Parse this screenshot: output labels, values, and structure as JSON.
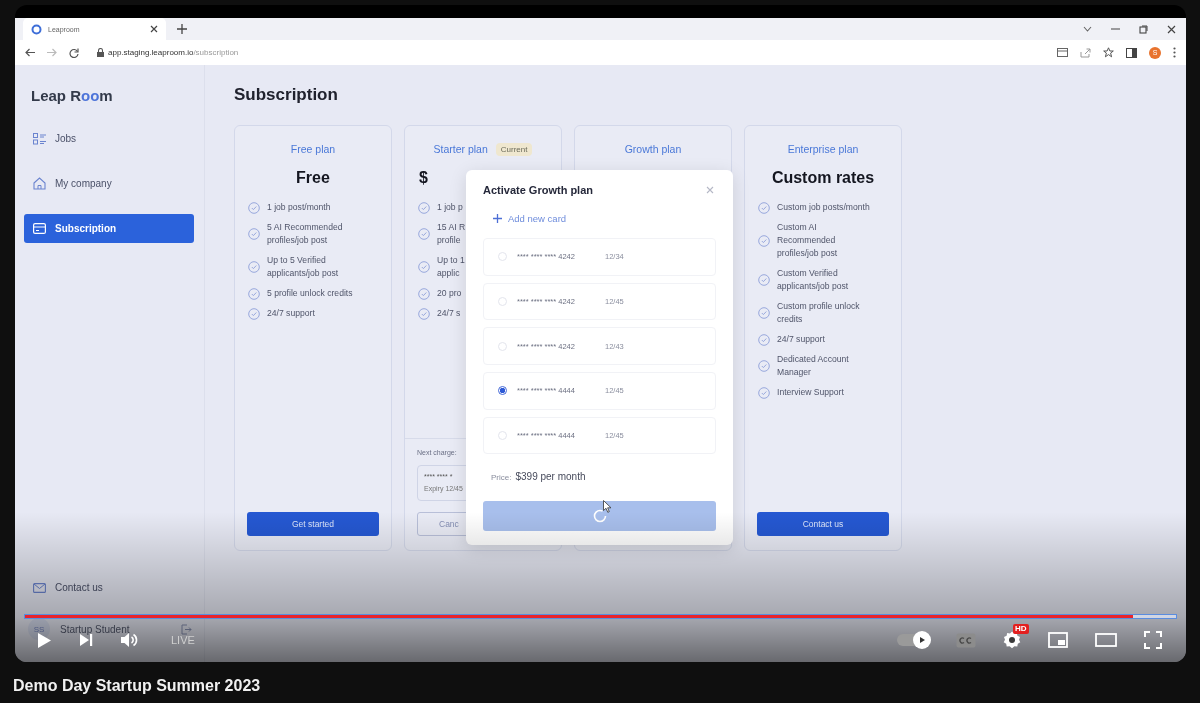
{
  "browser": {
    "tab": {
      "title": "Leaproom"
    },
    "address": {
      "host": "app.staging.leaproom.io",
      "path": "/subscription"
    },
    "profile_initial": "S"
  },
  "sidebar": {
    "logo": [
      {
        "text": "Leap R",
        "accent": false
      },
      {
        "text": "oo",
        "accent": true
      },
      {
        "text": "m",
        "accent": false
      }
    ],
    "items": [
      {
        "label": "Jobs",
        "selected": false
      },
      {
        "label": "My company",
        "selected": false
      },
      {
        "label": "Subscription",
        "selected": true
      }
    ],
    "contact": {
      "label": "Contact us"
    },
    "user": {
      "initials": "SS",
      "name": "Startup Student"
    }
  },
  "page_title": "Subscription",
  "plans": [
    {
      "title": "Free plan",
      "price": "Free",
      "features": [
        {
          "lines": [
            "1 job post/month"
          ]
        },
        {
          "lines": [
            "5 AI Recommended",
            "profiles/job post"
          ]
        },
        {
          "lines": [
            "Up to 5 Verified",
            "applicants/job post"
          ]
        },
        {
          "lines": [
            "5 profile unlock credits"
          ]
        },
        {
          "lines": [
            "24/7 support"
          ]
        }
      ],
      "button": {
        "label": "Get started",
        "kind": "primary"
      }
    },
    {
      "kind": "covered",
      "title": "Starter plan",
      "badge": "Current",
      "price": "$",
      "features": [
        {
          "lines": [
            "1 job p"
          ]
        },
        {
          "lines": [
            "15 AI R",
            "profile"
          ]
        },
        {
          "lines": [
            "Up to 1",
            "applic"
          ]
        },
        {
          "lines": [
            "20 pro"
          ]
        },
        {
          "lines": [
            "24/7 s"
          ]
        }
      ],
      "next_charge": "Next charge:",
      "payment": {
        "number": "**** **** *",
        "expiry": "Expiry 12/45"
      },
      "button": {
        "label": "Canc",
        "kind": "outline"
      }
    },
    {
      "title": "Growth plan"
    },
    {
      "title": "Enterprise plan",
      "price": "Custom rates",
      "features": [
        {
          "lines": [
            "Custom job posts/month"
          ]
        },
        {
          "lines": [
            "Custom AI",
            "Recommended",
            "profiles/job post"
          ]
        },
        {
          "lines": [
            "Custom Verified",
            "applicants/job post"
          ]
        },
        {
          "lines": [
            "Custom profile unlock",
            "credits"
          ]
        },
        {
          "lines": [
            "24/7 support"
          ]
        },
        {
          "lines": [
            "Dedicated Account",
            "Manager"
          ]
        },
        {
          "lines": [
            "Interview Support"
          ]
        }
      ],
      "button": {
        "label": "Contact us",
        "kind": "primary"
      }
    }
  ],
  "modal": {
    "title": "Activate Growth plan",
    "add_card": "Add new card",
    "cards": [
      {
        "number": "**** **** **** 4242",
        "expiry": "12/34",
        "selected": false
      },
      {
        "number": "**** **** **** 4242",
        "expiry": "12/45",
        "selected": false
      },
      {
        "number": "**** **** **** 4242",
        "expiry": "12/43",
        "selected": false
      },
      {
        "number": "**** **** **** 4444",
        "expiry": "12/45",
        "selected": true
      },
      {
        "number": "**** **** **** 4444",
        "expiry": "12/45",
        "selected": false
      }
    ],
    "price_label": "Price:",
    "price": "$399 per month",
    "loading": true
  },
  "player": {
    "progress": {
      "level": 0.963
    },
    "live": "LIVE",
    "autoplay": {
      "on": true
    },
    "quality_badge": "HD"
  },
  "video_title": "Demo Day Startup Summer 2023"
}
